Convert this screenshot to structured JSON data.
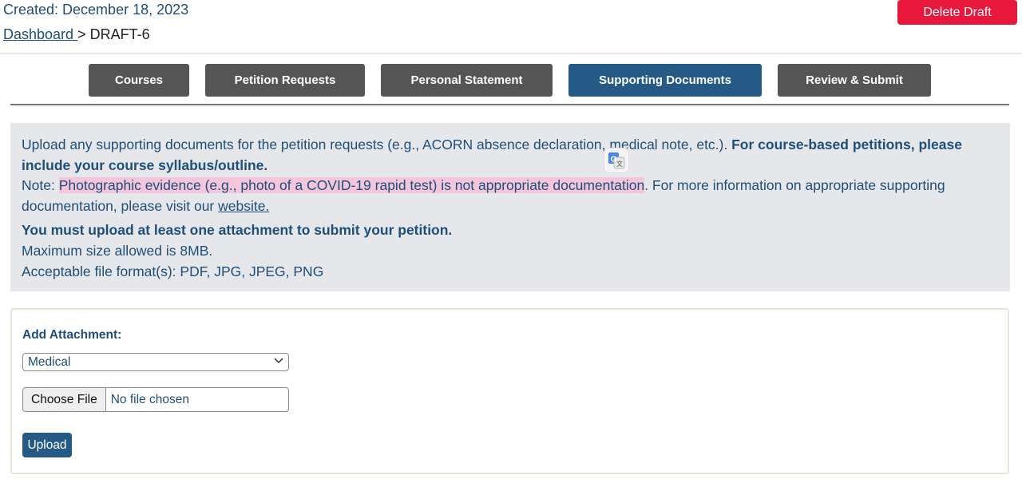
{
  "header": {
    "created": "Created: December 18, 2023",
    "breadcrumb_link": "Dashboard ",
    "breadcrumb_sep": "> ",
    "breadcrumb_current": "DRAFT-6",
    "delete_label": "Delete Draft"
  },
  "tabs": [
    {
      "label": "Courses",
      "active": false
    },
    {
      "label": "Petition Requests",
      "active": false
    },
    {
      "label": "Personal Statement",
      "active": false
    },
    {
      "label": "Supporting Documents",
      "active": true
    },
    {
      "label": "Review & Submit",
      "active": false
    }
  ],
  "info": {
    "line1_text": "Upload any supporting documents for the petition requests (e.g., ACORN absence declaration, medical note, etc.). ",
    "line1_bold": "For course-based petitions, please include your course syllabus/outline.",
    "note_prefix": "Note: ",
    "note_highlight": "Photographic evidence (e.g., photo of a COVID-19 rapid test) is not appropriate documentation",
    "note_suffix": ". For more information on appropriate supporting documentation, please visit our ",
    "note_link": "website.",
    "must_upload": "You must upload at least one attachment to submit your petition.",
    "max_size": "Maximum size allowed is 8MB.",
    "formats": "Acceptable file format(s): PDF, JPG, JPEG, PNG"
  },
  "attachment": {
    "label": "Add Attachment:",
    "selected_type": "Medical",
    "choose_file_label": "Choose File",
    "no_file_text": "No file chosen",
    "upload_label": "Upload"
  },
  "icons": {
    "translate": "translate-icon",
    "chevron": "chevron-down-icon"
  },
  "colors": {
    "primary": "#255a87",
    "tab_inactive": "#555555",
    "danger": "#e8183d",
    "text": "#1f4e79",
    "highlight": "#f3c6dc",
    "panel_bg": "#e5e7ea"
  }
}
